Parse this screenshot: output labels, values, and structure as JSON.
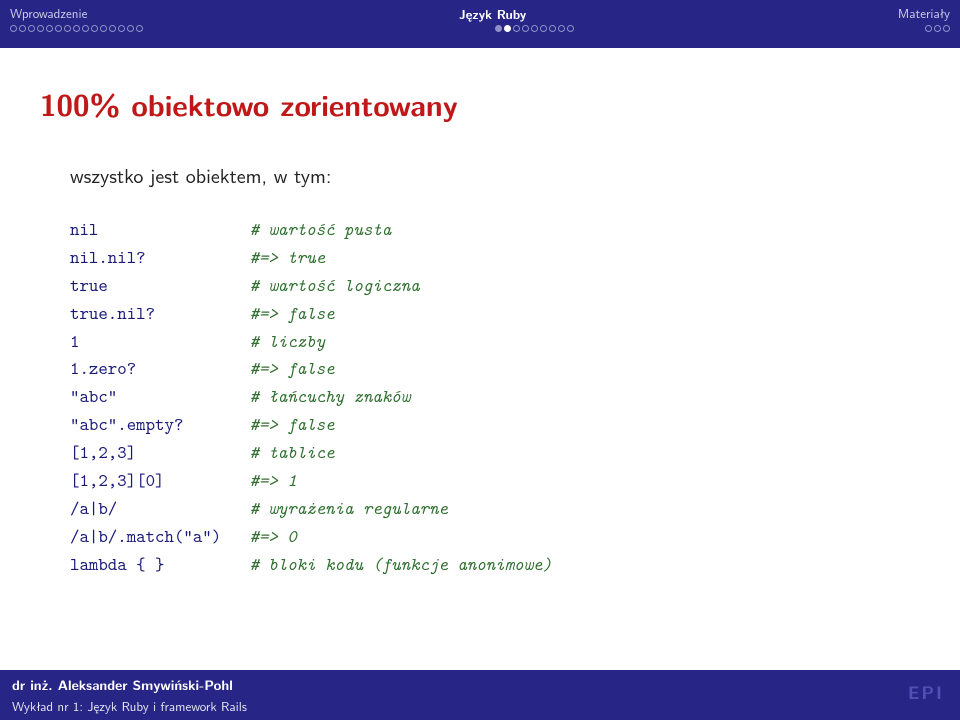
{
  "header": {
    "tab_left": "Wprowadzenie",
    "tab_center": "Język Ruby",
    "tab_right": "Materiały",
    "dots_left_total": 15,
    "dots_left_filled": 0,
    "dots_center_total": 9,
    "dots_center_filled": 1,
    "dots_center_current": 2,
    "dots_right_total": 3,
    "dots_right_filled": 0
  },
  "title": "100% obiektowo zorientowany",
  "intro": "wszystko jest obiektem, w tym:",
  "code": [
    {
      "expr": "nil",
      "comment": "# wartość pusta"
    },
    {
      "expr": "nil.nil?",
      "comment": "#=> true"
    },
    {
      "expr": "true",
      "comment": "# wartość logiczna"
    },
    {
      "expr": "true.nil?",
      "comment": "#=> false"
    },
    {
      "expr": "1",
      "comment": "# liczby"
    },
    {
      "expr": "1.zero?",
      "comment": "#=> false"
    },
    {
      "expr": "\"abc\"",
      "comment": "# łańcuchy znaków"
    },
    {
      "expr": "\"abc\".empty?",
      "comment": "#=> false"
    },
    {
      "expr": "[1,2,3]",
      "comment": "# tablice"
    },
    {
      "expr": "[1,2,3][0]",
      "comment": "#=> 1"
    },
    {
      "expr": "/a|b/",
      "comment": "# wyrażenia regularne"
    },
    {
      "expr": "/a|b/.match(\"a\")",
      "comment": "#=> 0"
    },
    {
      "expr": "lambda { }",
      "comment": "# bloki kodu (funkcje anonimowe)"
    }
  ],
  "footer": {
    "author": "dr inż. Aleksander Smywiński-Pohl",
    "lecture": "Wykład nr 1: Język Ruby i framework Rails",
    "logo": "EPI"
  }
}
